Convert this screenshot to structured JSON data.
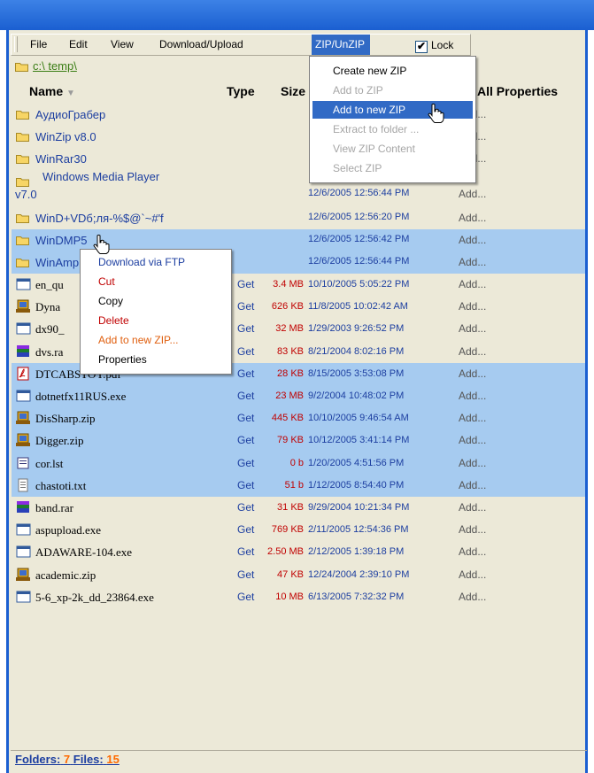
{
  "menu": {
    "file": "File",
    "edit": "Edit",
    "view": "View",
    "download_upload": "Download/Upload",
    "zip_unzip": "ZIP/UnZIP",
    "lock_label": "Lock",
    "lock_checked": true
  },
  "path": "c:\\ temp\\",
  "columns": {
    "name": "Name",
    "sort_arrow": "▼",
    "type": "Type",
    "size": "Size",
    "all_properties": "All Properties"
  },
  "zip_menu": {
    "items": [
      {
        "label": "Create new ZIP",
        "state": "enabled"
      },
      {
        "label": "Add to ZIP",
        "state": "disabled"
      },
      {
        "label": "Add to new ZIP",
        "state": "highlighted"
      },
      {
        "label": "Extract to folder ...",
        "state": "disabled"
      },
      {
        "label": "View ZIP Content",
        "state": "disabled"
      },
      {
        "label": "Select ZIP",
        "state": "disabled"
      }
    ]
  },
  "context_menu": {
    "items": [
      {
        "label": "Download via FTP",
        "color": "#1c3ea0"
      },
      {
        "label": "Cut",
        "color": "#c00000"
      },
      {
        "label": "Copy",
        "color": "#000000"
      },
      {
        "label": "Delete",
        "color": "#c00000"
      },
      {
        "label": "Add to new ZIP...",
        "color": "#e06010"
      },
      {
        "label": "Properties",
        "color": "#000000"
      }
    ]
  },
  "folders": [
    {
      "name": "АудиоГрабер",
      "date": "",
      "add": "Add...",
      "selected": false
    },
    {
      "name": "WinZip v8.0",
      "date": "",
      "add": "Add...",
      "selected": false
    },
    {
      "name": "WinRar30",
      "date": "",
      "add": "Add...",
      "selected": false
    },
    {
      "name": "Windows Media Player",
      "name2": "v7.0",
      "date": "12/6/2005 12:56:44 PM",
      "add": "Add...",
      "selected": false
    },
    {
      "name": "WinD+VDб;ля-%$@`~#'f",
      "date": "12/6/2005 12:56:20 PM",
      "add": "Add...",
      "selected": false
    },
    {
      "name": "WinDMP5",
      "date": "12/6/2005 12:56:42 PM",
      "add": "Add...",
      "selected": true
    },
    {
      "name": "WinAmp",
      "date": "12/6/2005 12:56:44 PM",
      "add": "Add...",
      "selected": true
    }
  ],
  "files": [
    {
      "name": "en_qu",
      "icon": "exe-icon",
      "type": "Get",
      "size": "3.4 MB",
      "date": "10/10/2005 5:05:22 PM",
      "add": "Add...",
      "selected": false
    },
    {
      "name": "Dyna",
      "icon": "zip-icon",
      "type": "Get",
      "size": "626 KB",
      "date": "11/8/2005 10:02:42 AM",
      "add": "Add...",
      "selected": false
    },
    {
      "name": "dx90_",
      "icon": "exe-icon",
      "type": "Get",
      "size": "32 MB",
      "date": "1/29/2003 9:26:52 PM",
      "add": "Add...",
      "selected": false
    },
    {
      "name": "dvs.ra",
      "icon": "rar-icon",
      "type": "Get",
      "size": "83 KB",
      "date": "8/21/2004 8:02:16 PM",
      "add": "Add...",
      "selected": false
    },
    {
      "name": "DTCABSTOY.pdf",
      "icon": "pdf-icon",
      "type": "Get",
      "size": "28 KB",
      "date": "8/15/2005 3:53:08 PM",
      "add": "Add...",
      "selected": true
    },
    {
      "name": "dotnetfx11RUS.exe",
      "icon": "exe-icon",
      "type": "Get",
      "size": "23 MB",
      "date": "9/2/2004 10:48:02 PM",
      "add": "Add...",
      "selected": true
    },
    {
      "name": "DisSharp.zip",
      "icon": "zip-icon",
      "type": "Get",
      "size": "445 KB",
      "date": "10/10/2005 9:46:54 AM",
      "add": "Add...",
      "selected": true
    },
    {
      "name": "Digger.zip",
      "icon": "zip-icon",
      "type": "Get",
      "size": "79 KB",
      "date": "10/12/2005 3:41:14 PM",
      "add": "Add...",
      "selected": true
    },
    {
      "name": "cor.lst",
      "icon": "lst-icon",
      "type": "Get",
      "size": "0 b",
      "date": "1/20/2005 4:51:56 PM",
      "add": "Add...",
      "selected": true
    },
    {
      "name": "chastoti.txt",
      "icon": "txt-icon",
      "type": "Get",
      "size": "51 b",
      "date": "1/12/2005 8:54:40 PM",
      "add": "Add...",
      "selected": true
    },
    {
      "name": "band.rar",
      "icon": "rar-icon",
      "type": "Get",
      "size": "31 KB",
      "date": "9/29/2004 10:21:34 PM",
      "add": "Add...",
      "selected": false
    },
    {
      "name": "aspupload.exe",
      "icon": "exe-icon",
      "type": "Get",
      "size": "769 KB",
      "date": "2/11/2005 12:54:36 PM",
      "add": "Add...",
      "selected": false
    },
    {
      "name": "ADAWARE-104.exe",
      "icon": "exe-icon",
      "type": "Get",
      "size": "2.50 MB",
      "date": "2/12/2005 1:39:18 PM",
      "add": "Add...",
      "selected": false
    },
    {
      "name": "academic.zip",
      "icon": "zip-icon",
      "type": "Get",
      "size": "47 KB",
      "date": "12/24/2004 2:39:10 PM",
      "add": "Add...",
      "selected": false
    },
    {
      "name": "5-6_xp-2k_dd_23864.exe",
      "icon": "exe-icon",
      "type": "Get",
      "size": "10 MB",
      "date": "6/13/2005 7:32:32 PM",
      "add": "Add...",
      "selected": false
    }
  ],
  "status": {
    "folders_label": "Folders:",
    "folders_count": "7",
    "files_label": "Files:",
    "files_count": "15"
  },
  "colors": {
    "titlebar": "#1b5fd1",
    "selection": "#a6cbf0",
    "menu_highlight": "#316ac5",
    "link_blue": "#1c3ea0",
    "size_red": "#c00000",
    "count_orange": "#ff6a00"
  }
}
